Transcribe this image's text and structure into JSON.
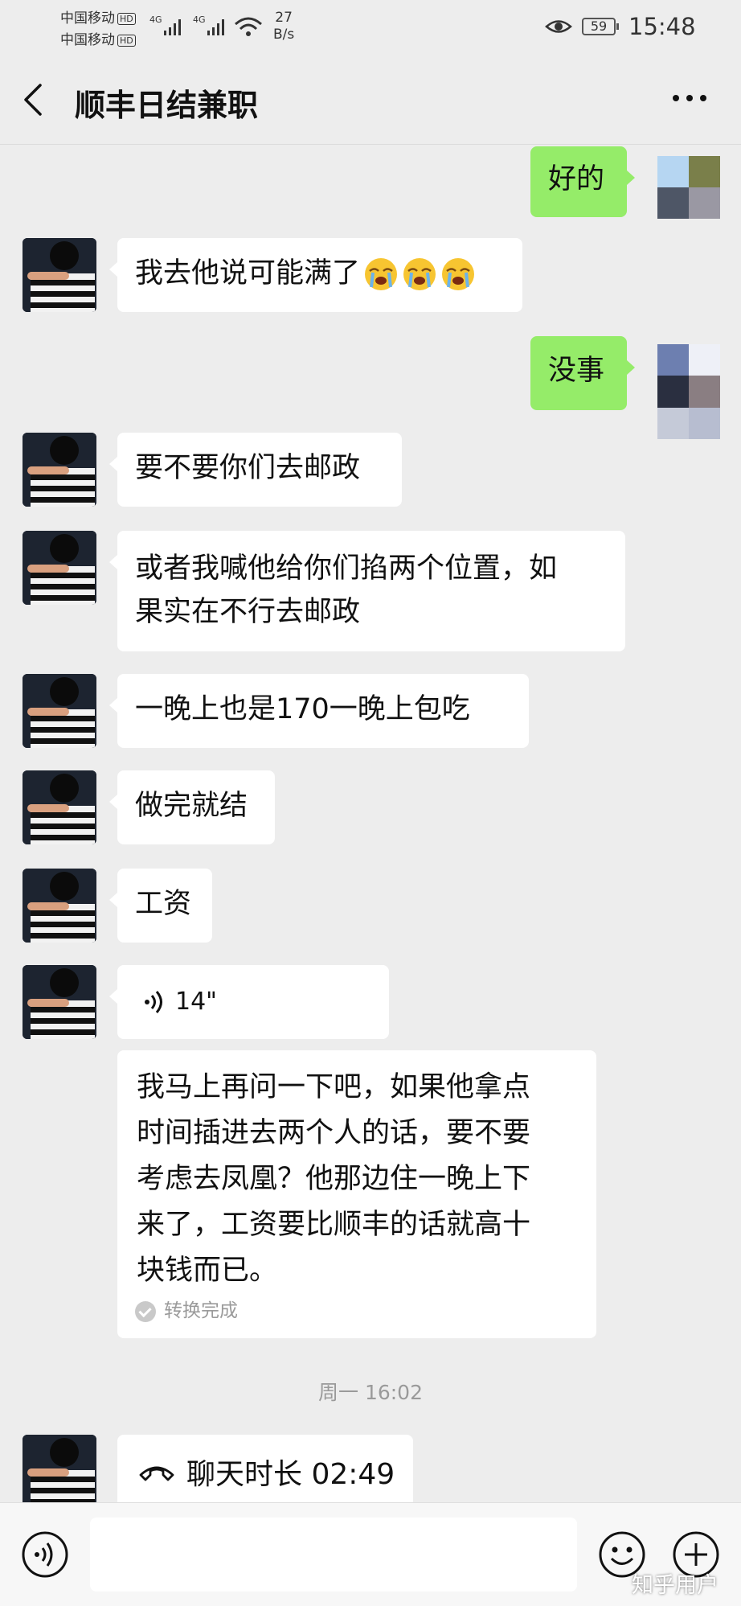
{
  "status_bar": {
    "carrier1": "中国移动",
    "carrier2": "中国移动",
    "hd": "HD",
    "net_speed_value": "27",
    "net_speed_unit": "B/s",
    "battery": "59",
    "time": "15:48"
  },
  "header": {
    "title": "顺丰日结兼职",
    "back_icon": "chevron-left-icon",
    "more_icon": "more-dots-icon"
  },
  "messages": [
    {
      "side": "right",
      "text": "好的"
    },
    {
      "side": "left",
      "text": "我去他说可能满了",
      "emoji": [
        "loudly-crying-emoji",
        "loudly-crying-emoji",
        "loudly-crying-emoji"
      ]
    },
    {
      "side": "right",
      "text": "没事"
    },
    {
      "side": "left",
      "text": "要不要你们去邮政"
    },
    {
      "side": "left",
      "text_line1": "或者我喊他给你们掐两个位置，如",
      "text_line2": "果实在不行去邮政"
    },
    {
      "side": "left",
      "text": "一晚上也是170一晚上包吃"
    },
    {
      "side": "left",
      "text": "做完就结"
    },
    {
      "side": "left",
      "text": "工资"
    },
    {
      "side": "left",
      "type": "voice",
      "duration": "14\"",
      "transcript": [
        "我马上再问一下吧，如果他拿点",
        "时间插进去两个人的话，要不要",
        "考虑去凤凰？他那边住一晚上下",
        "来了，工资要比顺丰的话就高十",
        "块钱而已。"
      ],
      "transcript_status": "转换完成"
    },
    {
      "side": "left",
      "type": "call",
      "timestamp": "周一 16:02",
      "label": "聊天时长 02:49"
    }
  ],
  "input_bar": {
    "voice_icon": "voice-input-icon",
    "emoji_icon": "emoji-icon",
    "plus_icon": "plus-icon"
  },
  "watermark": "知乎用户",
  "colors": {
    "right_bubble": "#95ec69",
    "left_bubble": "#ffffff",
    "background": "#ededed"
  }
}
